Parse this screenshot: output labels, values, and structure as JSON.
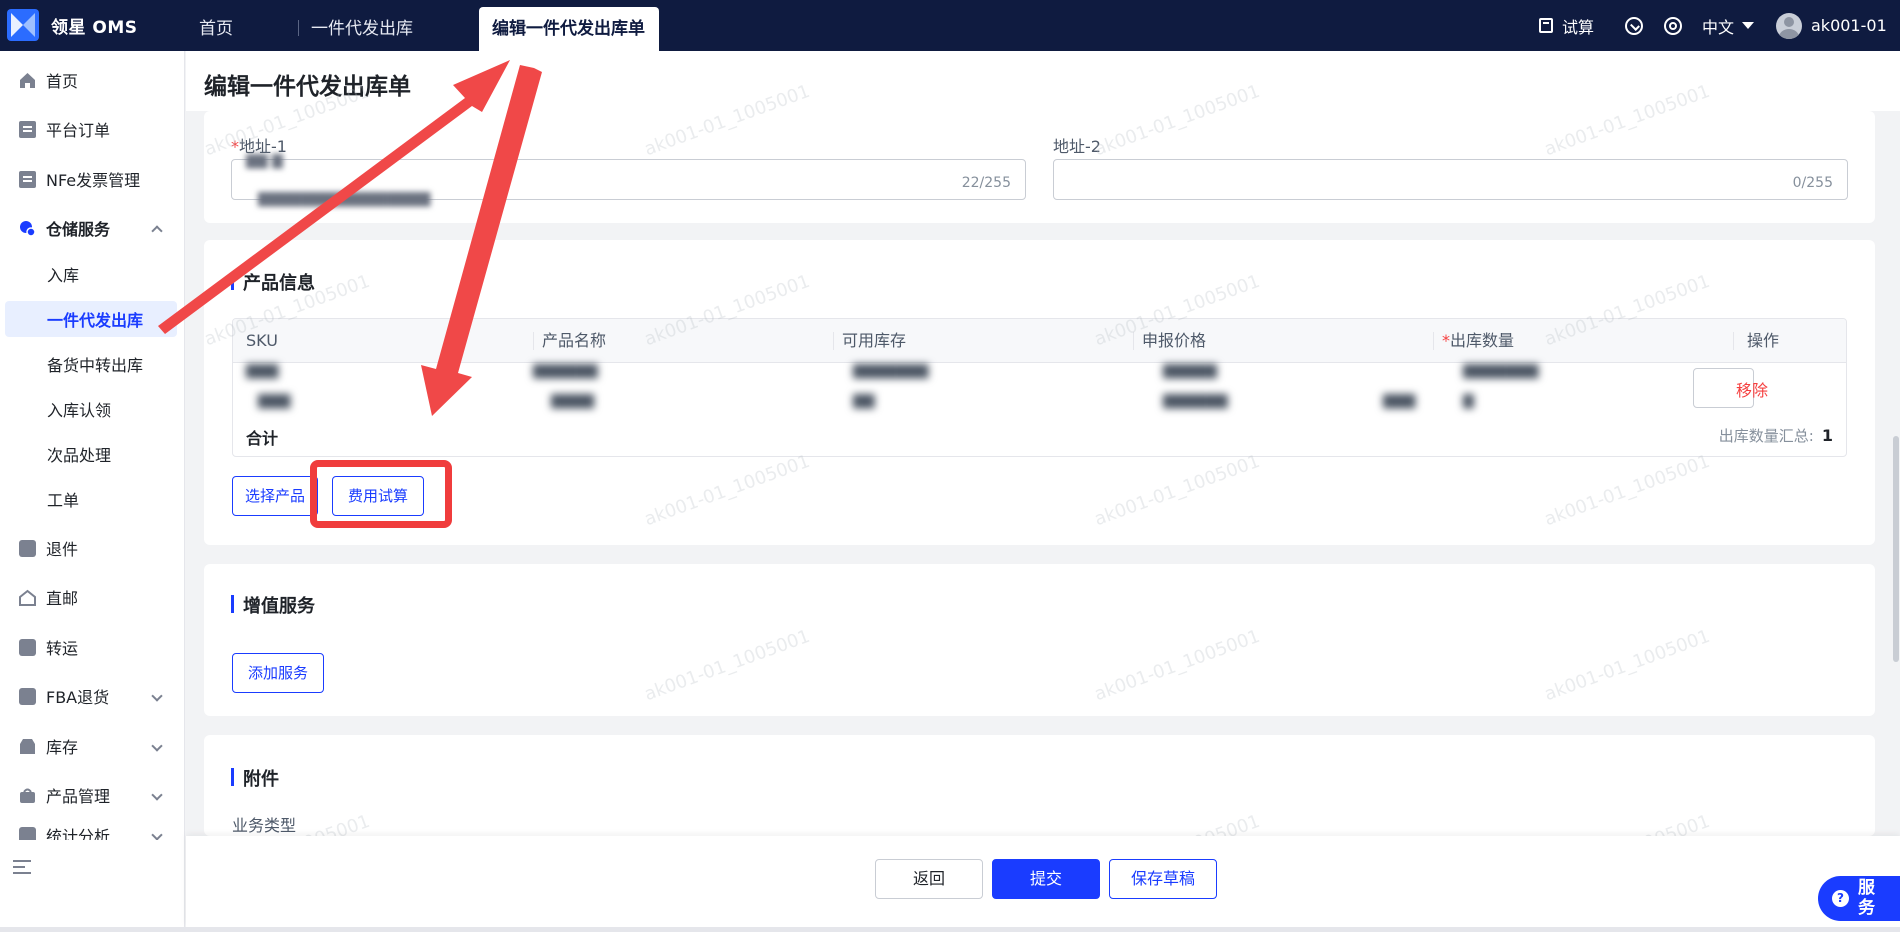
{
  "brand": {
    "name": "领星 OMS"
  },
  "tabs": [
    {
      "label": "首页"
    },
    {
      "label": "一件代发出库"
    },
    {
      "label": "编辑一件代发出库单"
    }
  ],
  "topbar": {
    "calc_label": "试算",
    "language": "中文",
    "username": "ak001-01"
  },
  "sidebar": {
    "items": [
      {
        "label": "首页",
        "icon": "home-icon"
      },
      {
        "label": "平台订单",
        "icon": "clipboard-icon"
      },
      {
        "label": "NFe发票管理",
        "icon": "clipboard-icon"
      },
      {
        "label": "仓储服务",
        "icon": "warehouse-icon"
      },
      {
        "label": "退件",
        "icon": "return-icon"
      },
      {
        "label": "直邮",
        "icon": "house-icon"
      },
      {
        "label": "转运",
        "icon": "transfer-icon"
      },
      {
        "label": "FBA退货",
        "icon": "amazon-icon"
      },
      {
        "label": "库存",
        "icon": "store-icon"
      },
      {
        "label": "产品管理",
        "icon": "bag-icon"
      },
      {
        "label": "统计分析",
        "icon": "chart-icon"
      }
    ],
    "warehouse_sub": [
      {
        "label": "入库"
      },
      {
        "label": "一件代发出库"
      },
      {
        "label": "备货中转出库"
      },
      {
        "label": "入库认领"
      },
      {
        "label": "次品处理"
      },
      {
        "label": "工单"
      }
    ]
  },
  "page": {
    "title": "编辑一件代发出库单"
  },
  "address": {
    "address1_label": "地址-1",
    "address1_count": "22/255",
    "address2_label": "地址-2",
    "address2_count": "0/255"
  },
  "product_info": {
    "title": "产品信息",
    "columns": [
      "SKU",
      "产品名称",
      "可用库存",
      "申报价格",
      "出库数量",
      "操作"
    ],
    "remove_label": "移除",
    "total_label": "合计",
    "total_qty_label": "出库数量汇总:",
    "total_qty_value": "1",
    "select_product_button": "选择产品",
    "fee_trial_button": "费用试算"
  },
  "value_added": {
    "title": "增值服务",
    "add_button": "添加服务"
  },
  "attachment": {
    "title": "附件",
    "business_type_label": "业务类型"
  },
  "footer": {
    "back_button": "返回",
    "submit_button": "提交",
    "save_draft_button": "保存草稿"
  },
  "service_float": {
    "label": "服务"
  },
  "watermark_text": "ak001-01_1005001",
  "colors": {
    "topbar_bg": "#0f1b40",
    "primary": "#1a3cff",
    "danger": "#f53f3f",
    "annotation_red": "#f03c3c"
  }
}
